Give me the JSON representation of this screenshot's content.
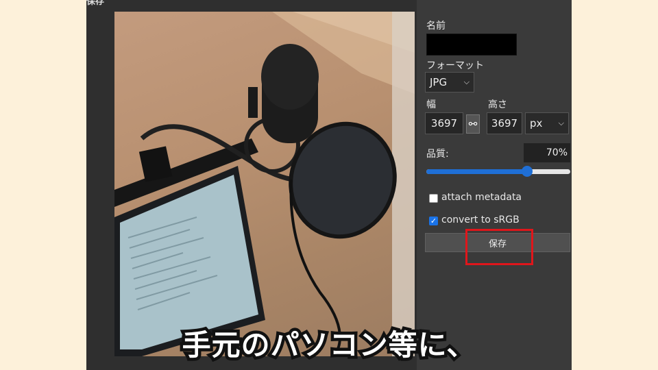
{
  "dialog": {
    "title": "保存",
    "close_label": "×"
  },
  "panel": {
    "name_label": "名前",
    "format_label": "フォーマット",
    "format_value": "JPG",
    "width_label": "幅",
    "height_label": "高さ",
    "width_value": "3697",
    "height_value": "3697",
    "unit_value": "px",
    "link_icon": "chain-link-icon",
    "quality_label": "品質:",
    "quality_value": "70%",
    "quality_level": 0.7,
    "attach_metadata_label": "attach metadata",
    "attach_metadata_checked": false,
    "convert_srgb_label": "convert to sRGB",
    "convert_srgb_checked": true,
    "save_button_label": "保存"
  },
  "annotation": {
    "highlight_color": "#e0161b"
  },
  "subtitle": {
    "text": "手元のパソコン等に、"
  },
  "colors": {
    "background": "#fdf1da",
    "dialog": "#2f2f2f",
    "accent": "#1f6fd6"
  }
}
